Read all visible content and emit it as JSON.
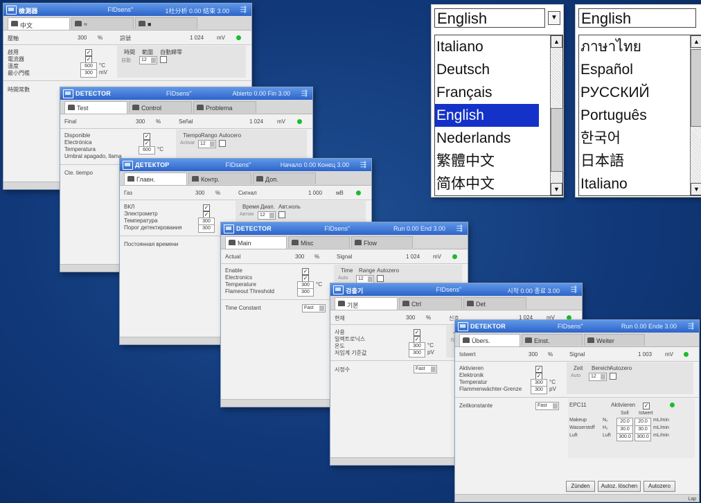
{
  "windows": [
    {
      "title": "檢測器",
      "fidelity": "FIDsens\"",
      "power": "1社分析 0.00   結束 3.00",
      "tabs": [
        "中文",
        "≈",
        "■"
      ],
      "row1": [
        "壓軸",
        "300",
        "%",
        "訊號",
        "1 024",
        "mV"
      ],
      "checks": [
        "啟用",
        "電流器",
        "溫度",
        "最小門檻"
      ],
      "inputs": [
        "600",
        "300"
      ],
      "units": [
        "°C",
        "mV"
      ],
      "right_labels": [
        "時間",
        "範圍",
        "自動歸零"
      ],
      "auto_label": "自動",
      "range": "12",
      "const_label": "時間常數"
    },
    {
      "title": "DETECTOR",
      "fidelity": "FIDsens\"",
      "power": "Abierto 0.00   Fin 3.00",
      "tabs": [
        "Test",
        "Control",
        "Problema"
      ],
      "row1": [
        "Final",
        "300",
        "%",
        "Señal",
        "1 024",
        "mV"
      ],
      "checks": [
        "Disponible",
        "Electrónica",
        "Temperatura",
        "Umbral apagado, llama"
      ],
      "inputs": [
        "600"
      ],
      "units": [
        "°C"
      ],
      "right_labels": [
        "Tiempo",
        "Rango",
        "Autocero"
      ],
      "auto_label": "Activar",
      "range": "12",
      "const_label": "Cte. tiempo"
    },
    {
      "title": "ДЕТЕКТОР",
      "fidelity": "FIDsens\"",
      "power": "Начало 0.00   Конец 3.00",
      "tabs": [
        "Главн.",
        "Контр.",
        "Доп."
      ],
      "row1": [
        "Газ",
        "300",
        "%",
        "Сигнал",
        "1 000",
        "мВ"
      ],
      "checks": [
        "ВКЛ",
        "Электрометр",
        "Температура",
        "Порог детектирования"
      ],
      "inputs": [
        "300",
        "300"
      ],
      "units": [],
      "right_labels": [
        "Время",
        "Диап.",
        "Авт.ноль"
      ],
      "auto_label": "Автом",
      "range": "12",
      "const_label": "Постоянная времени"
    },
    {
      "title": "DETECTOR",
      "fidelity": "FIDsens\"",
      "power": "Run 0.00   End 3.00",
      "tabs": [
        "Main",
        "Misc",
        "Flow"
      ],
      "row1": [
        "Actual",
        "300",
        "%",
        "Signal",
        "1 024",
        "mV"
      ],
      "checks": [
        "Enable",
        "Electronics",
        "Temperature",
        "Flameout Threshold"
      ],
      "inputs": [
        "300",
        "300"
      ],
      "units": [
        "°C"
      ],
      "right_labels": [
        "Time",
        "Range",
        "Autozero"
      ],
      "auto_label": "Auto",
      "range": "12",
      "const_label": "Time Constant",
      "dropdown": "Fast"
    },
    {
      "title": "검출기",
      "fidelity": "FIDsens\"",
      "power": "시작 0.00   종료 3.00",
      "tabs": [
        "기본",
        "Ctrl",
        "Det"
      ],
      "row1": [
        "현재",
        "300",
        "%",
        "신호",
        "1 024",
        "mV"
      ],
      "checks": [
        "사용",
        "일렉트로닉스",
        "온도",
        "저임계 기준값"
      ],
      "inputs": [
        "300",
        "300"
      ],
      "units": [
        "°C",
        "pV"
      ],
      "right_labels": [
        "시간",
        "범위",
        "자동"
      ],
      "auto_label": "자동",
      "range": "12",
      "const_label": "시정수",
      "dropdown": "Fast"
    },
    {
      "title": "DETEKTOR",
      "fidelity": "FIDsens\"",
      "power": "Run 0.00   Ende 3.00",
      "tabs": [
        "Übers.",
        "Einst.",
        "Weiter"
      ],
      "row1": [
        "Istwert",
        "300",
        "%",
        "Signal",
        "1 003",
        "mV"
      ],
      "checks": [
        "Aktivieren",
        "Elektronik",
        "Temperatur",
        "Flammenwächter-Grenze"
      ],
      "inputs": [
        "300",
        "300"
      ],
      "units": [
        "°C",
        "pV"
      ],
      "right_labels": [
        "Zeit",
        "Bereich",
        "Autozero"
      ],
      "auto_label": "Auto",
      "range": "12",
      "const_label": "Zeitkonstante",
      "dropdown": "Fast",
      "epc": {
        "label": "EPC11",
        "active": "Aktivieren",
        "cols": [
          "Soll",
          "Istwert"
        ],
        "rows": [
          {
            "name": "Makeup",
            "gas": "N₂",
            "soll": "20.0",
            "ist": "20.0",
            "unit": "mL/min"
          },
          {
            "name": "Wasserstoff",
            "gas": "H₂",
            "soll": "30.0",
            "ist": "30.0",
            "unit": "mL/min"
          },
          {
            "name": "Luft",
            "gas": "Luft",
            "soll": "300.0",
            "ist": "300.0",
            "unit": "mL/min"
          }
        ]
      },
      "buttons": [
        "Zünden",
        "Autoz. löschen",
        "Autozero"
      ],
      "status": "Lap"
    }
  ],
  "language_lists": [
    {
      "selected": "English",
      "items": [
        "Italiano",
        "Deutsch",
        "Français",
        "English",
        "Nederlands",
        "繁體中文",
        "简体中文"
      ],
      "highlighted": "English"
    },
    {
      "selected": "English",
      "items": [
        "ภาษาไทย",
        "Español",
        "РУССКИЙ",
        "Português",
        "한국어",
        "日本語",
        "Italiano"
      ],
      "highlighted": ""
    }
  ],
  "colors": {
    "titlebar": "#2d64c9",
    "highlight": "#1432c8",
    "status_ok": "#1bbb2e"
  }
}
